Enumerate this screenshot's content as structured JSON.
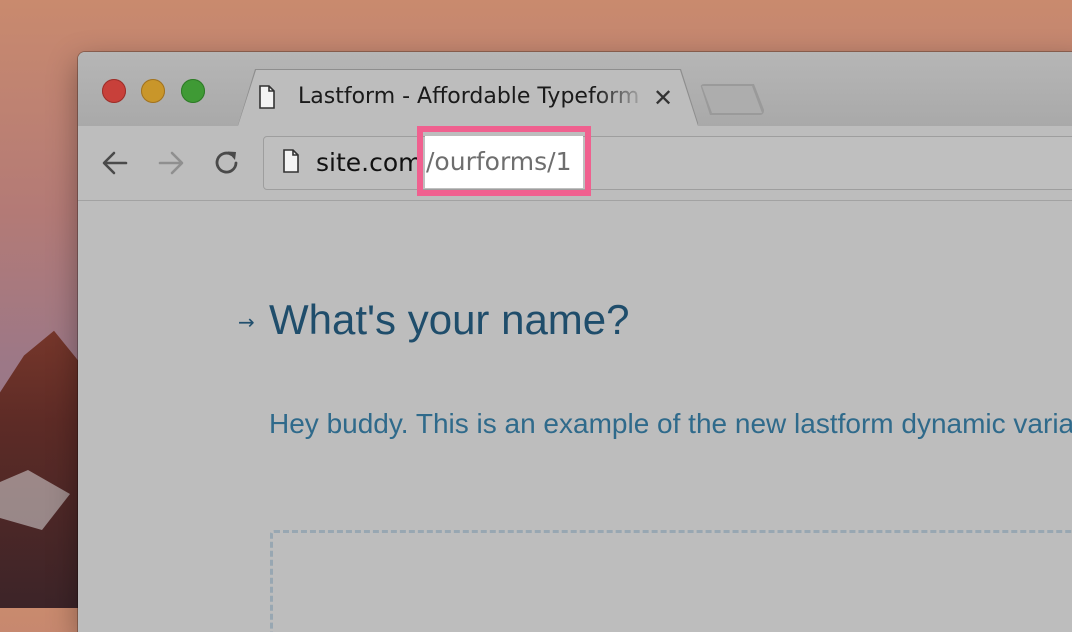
{
  "browser": {
    "tab": {
      "title": "Lastform - Affordable Typeform",
      "close_glyph": "✕",
      "icon": "document-icon"
    },
    "new_tab_icon": "new-tab-icon",
    "toolbar": {
      "back_icon": "arrow-left-icon",
      "forward_icon": "arrow-right-icon",
      "reload_icon": "reload-icon"
    },
    "address_bar": {
      "host": "site.com",
      "path": "/ourforms/1",
      "highlight_color": "#f0608f"
    }
  },
  "form": {
    "question_arrow": "→",
    "question": "What's your name?",
    "description": "Hey buddy. This is an example of the new lastform dynamic variables"
  },
  "colors": {
    "question_text": "#1f4d6b",
    "description_text": "#2f6a8b",
    "traffic_close": "#c8403a",
    "traffic_minimize": "#c9962a",
    "traffic_maximize": "#3f9a35"
  }
}
